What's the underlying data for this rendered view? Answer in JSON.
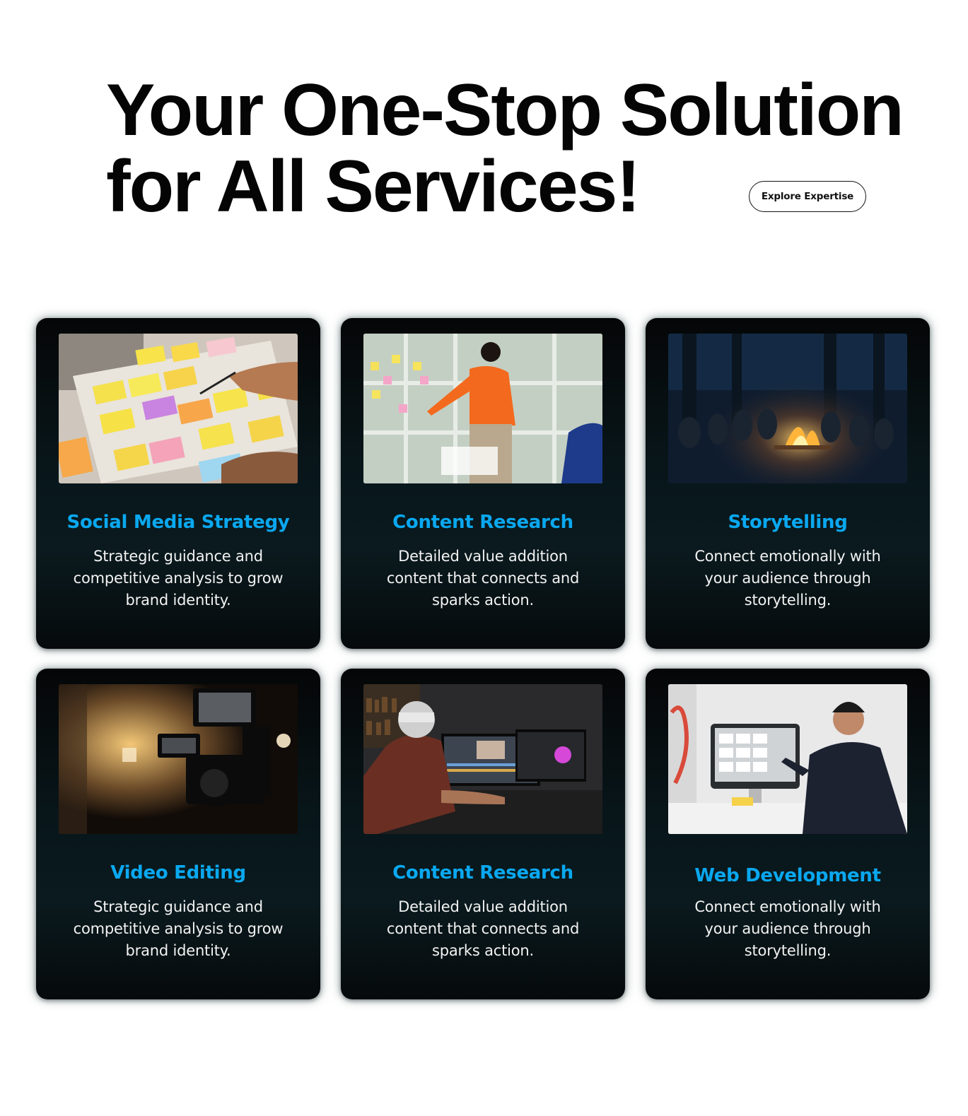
{
  "hero": {
    "title_line1": "Your One-Stop Solution",
    "title_line2": "for All Services!",
    "cta_label": "Explore Expertise"
  },
  "services": [
    {
      "title": "Social Media Strategy",
      "description": "Strategic guidance and competitive analysis to grow brand identity.",
      "image": "sticky-notes-planning-photo"
    },
    {
      "title": "Content Research",
      "description": "Detailed value addition content that connects and sparks action.",
      "image": "presenter-whiteboard-photo"
    },
    {
      "title": "Storytelling",
      "description": "Connect emotionally with your audience through storytelling.",
      "image": "campfire-night-photo"
    },
    {
      "title": "Video Editing",
      "description": "Strategic guidance and competitive analysis to grow brand identity.",
      "image": "video-camera-rig-photo"
    },
    {
      "title": "Content Research",
      "description": "Detailed value addition content that connects and sparks action.",
      "image": "editor-at-monitors-photo"
    },
    {
      "title": "Web Development",
      "description": "Connect emotionally with your audience through storytelling.",
      "image": "designer-at-imac-photo"
    }
  ],
  "colors": {
    "accent": "#0aa8f0",
    "card_bg": "#07121a",
    "text_dark": "#050505"
  }
}
